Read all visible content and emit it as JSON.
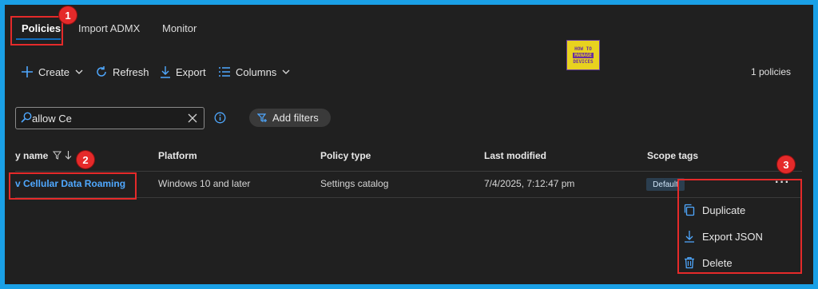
{
  "tabs": [
    {
      "label": "Policies"
    },
    {
      "label": "Import ADMX"
    },
    {
      "label": "Monitor"
    }
  ],
  "toolbar": {
    "create_label": "Create",
    "refresh_label": "Refresh",
    "export_label": "Export",
    "columns_label": "Columns",
    "count_text": "1 policies"
  },
  "logo": {
    "line1": "HOW TO",
    "line2": "MANAGE",
    "line3": "DEVICES"
  },
  "search": {
    "value": "allow Ce"
  },
  "filters": {
    "add_label": "Add filters"
  },
  "table": {
    "headers": [
      "y name",
      "Platform",
      "Policy type",
      "Last modified",
      "Scope tags"
    ],
    "rows": [
      {
        "name": "v Cellular Data Roaming",
        "platform": "Windows 10 and later",
        "policy_type": "Settings catalog",
        "last_modified": "7/4/2025, 7:12:47 pm",
        "scope_tag": "Default",
        "more": "···"
      }
    ]
  },
  "context_menu": {
    "items": [
      {
        "label": "Duplicate",
        "icon": "copy-icon"
      },
      {
        "label": "Export JSON",
        "icon": "download-icon"
      },
      {
        "label": "Delete",
        "icon": "trash-icon"
      }
    ]
  },
  "callouts": [
    "1",
    "2",
    "3"
  ],
  "colors": {
    "accent": "#0f6cbd",
    "link": "#4fa8ff",
    "highlight": "#e52a2a",
    "frame": "#1aa0e6"
  }
}
